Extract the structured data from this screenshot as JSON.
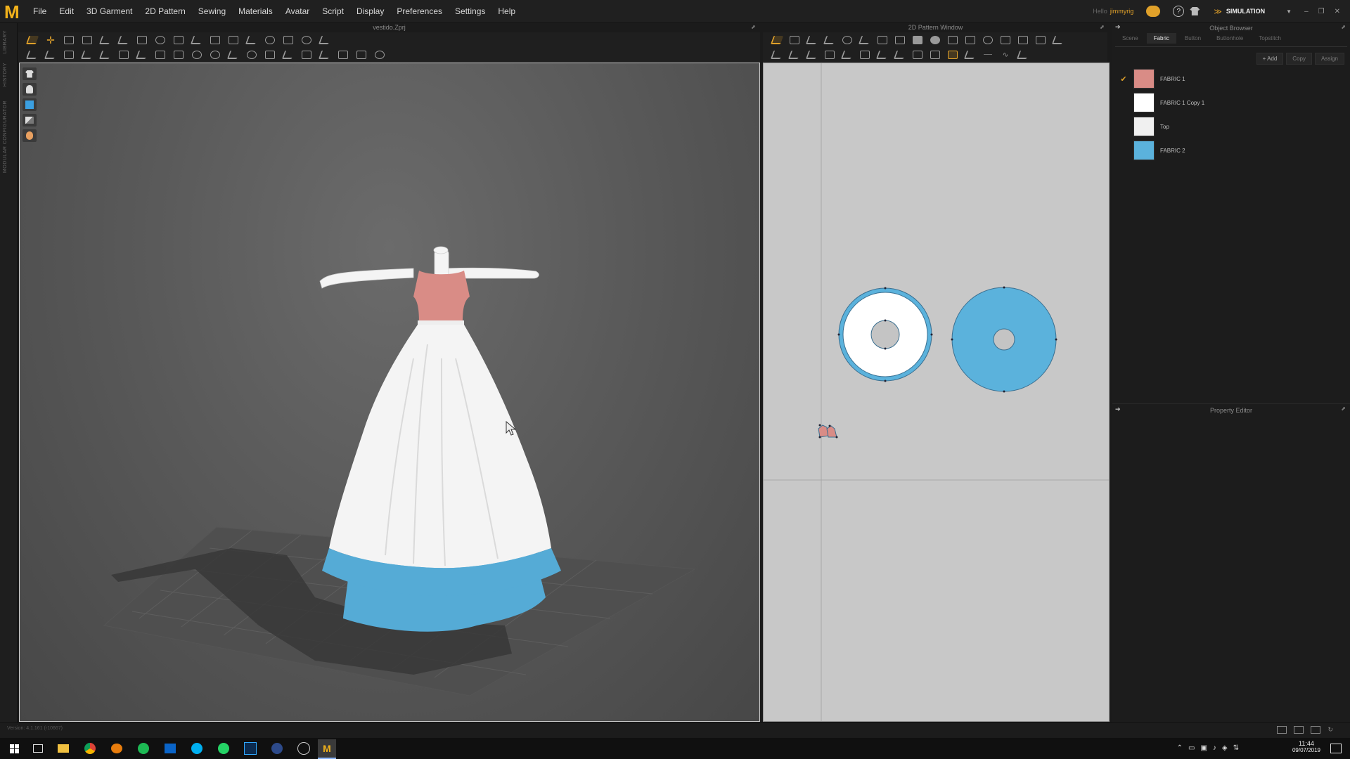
{
  "app": {
    "logo_letter": "M",
    "menus": [
      "File",
      "Edit",
      "3D Garment",
      "2D Pattern",
      "Sewing",
      "Materials",
      "Avatar",
      "Script",
      "Display",
      "Preferences",
      "Settings",
      "Help"
    ],
    "user_prefix": "Hello",
    "username": "jimmyrig",
    "mode": "SIMULATION"
  },
  "left_strip": [
    "LIBRARY",
    "HISTORY",
    "MODULAR CONFIGURATOR"
  ],
  "viewport3d": {
    "title": "vestido.Zprj"
  },
  "pattern2d": {
    "title": "2D Pattern Window"
  },
  "object_browser": {
    "title": "Object Browser",
    "tabs": [
      "Scene",
      "Fabric",
      "Button",
      "Buttonhole",
      "Topstitch"
    ],
    "active_tab": "Fabric",
    "buttons": {
      "add": "+ Add",
      "copy": "Copy",
      "assign": "Assign"
    },
    "fabrics": [
      {
        "name": "FABRIC 1",
        "color": "#d98c86",
        "checked": true
      },
      {
        "name": "FABRIC 1 Copy 1",
        "color": "#ffffff",
        "checked": false
      },
      {
        "name": "Top",
        "color": "#f0f0f0",
        "checked": false
      },
      {
        "name": "FABRIC 2",
        "color": "#5bb2dc",
        "checked": false
      }
    ]
  },
  "property_editor": {
    "title": "Property Editor"
  },
  "status": {
    "version": "Version: 4.1.161 (r10667)"
  },
  "taskbar": {
    "time": "11:44",
    "date": "09/07/2019"
  },
  "colors": {
    "accent": "#e0a12a",
    "blue_fabric": "#5bb2dc",
    "pink_fabric": "#d98c86"
  }
}
